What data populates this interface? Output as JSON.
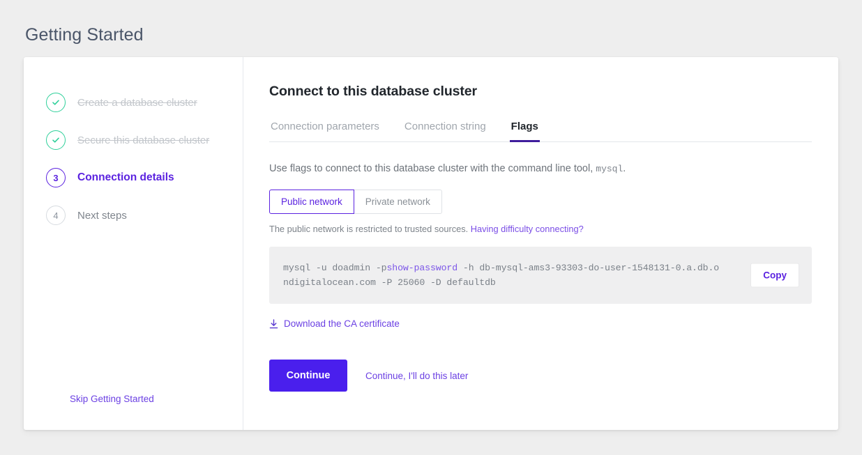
{
  "page": {
    "title": "Getting Started"
  },
  "sidebar": {
    "steps": [
      {
        "number": "1",
        "label": "Create a database cluster",
        "state": "completed",
        "icon": "check-icon"
      },
      {
        "number": "2",
        "label": "Secure this database cluster",
        "state": "completed",
        "icon": "check-icon"
      },
      {
        "number": "3",
        "label": "Connection details",
        "state": "current",
        "icon": ""
      },
      {
        "number": "4",
        "label": "Next steps",
        "state": "pending",
        "icon": ""
      }
    ],
    "skip_label": "Skip Getting Started"
  },
  "main": {
    "title": "Connect to this database cluster",
    "tabs": [
      {
        "label": "Connection parameters",
        "active": false
      },
      {
        "label": "Connection string",
        "active": false
      },
      {
        "label": "Flags",
        "active": true
      }
    ],
    "intro_text": "Use flags to connect to this database cluster with the command line tool,",
    "intro_code": "mysql",
    "intro_suffix": ".",
    "network_options": [
      {
        "label": "Public network",
        "selected": true
      },
      {
        "label": "Private network",
        "selected": false
      }
    ],
    "note_text": "The public network is restricted to trusted sources.",
    "note_link": "Having difficulty connecting?",
    "command": {
      "prefix": "mysql -u doadmin -p",
      "reveal": "show-password",
      "suffix": " -h db-mysql-ams3-93303-do-user-1548131-0.a.db.ondigitalocean.com -P 25060 -D defaultdb",
      "copy_label": "Copy"
    },
    "ca_certificate": {
      "icon": "download-icon",
      "label": "Download the CA certificate"
    },
    "continue_label": "Continue",
    "later_label": "Continue, I'll do this later"
  },
  "colors": {
    "accent_purple": "#5b22e0",
    "primary_button": "#4a1fed",
    "link_purple": "#6b40e3",
    "success_green": "#2fd09a",
    "tab_underline": "#3f1d9c",
    "page_bg": "#eeeeee",
    "code_bg": "#efeff0"
  }
}
